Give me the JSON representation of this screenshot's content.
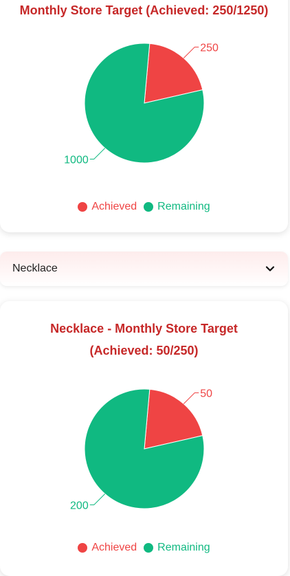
{
  "colors": {
    "achieved": "#ef4444",
    "remaining": "#10b981",
    "title": "#c62828"
  },
  "overall_card": {
    "title": "Monthly Store Target (Achieved: 250/1250)",
    "legend": {
      "achieved": "Achieved",
      "remaining": "Remaining"
    }
  },
  "category_select": {
    "selected": "Necklace",
    "icon": "chevron-down-icon"
  },
  "category_card": {
    "title_line1": "Necklace - Monthly Store Target",
    "title_line2": "(Achieved: 50/250)",
    "legend": {
      "achieved": "Achieved",
      "remaining": "Remaining"
    }
  },
  "chart_data": [
    {
      "type": "pie",
      "title": "Monthly Store Target (Achieved: 250/1250)",
      "categories": [
        "Achieved",
        "Remaining"
      ],
      "values": [
        250,
        1000
      ],
      "labels": [
        "250",
        "1000"
      ],
      "legend": "bottom"
    },
    {
      "type": "pie",
      "title": "Necklace - Monthly Store Target (Achieved: 50/250)",
      "categories": [
        "Achieved",
        "Remaining"
      ],
      "values": [
        50,
        200
      ],
      "labels": [
        "50",
        "200"
      ],
      "legend": "bottom"
    }
  ]
}
